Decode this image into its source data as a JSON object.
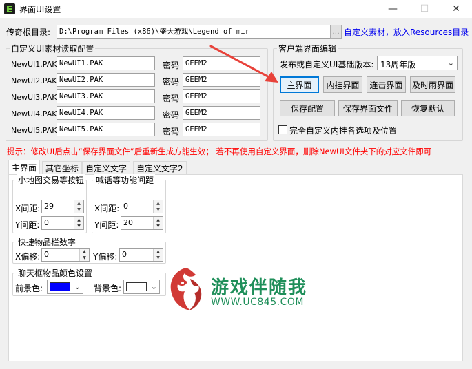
{
  "window": {
    "title": "界面UI设置",
    "minimize": "—",
    "maximize": "☐",
    "close": "✕"
  },
  "root_dir": {
    "label": "传奇根目录:",
    "value": "D:\\Program Files (x86)\\盛大游戏\\Legend of mir",
    "browse": "...",
    "hint_link": "自定义素材，放入Resources目录"
  },
  "materials_group": {
    "title": "自定义UI素材读取配置",
    "password_label": "密码",
    "rows": [
      {
        "label": "NewUI1.PAK",
        "file": "NewUI1.PAK",
        "password": "GEEM2"
      },
      {
        "label": "NewUI2.PAK",
        "file": "NewUI2.PAK",
        "password": "GEEM2"
      },
      {
        "label": "NewUI3.PAK",
        "file": "NewUI3.PAK",
        "password": "GEEM2"
      },
      {
        "label": "NewUI4.PAK",
        "file": "NewUI4.PAK",
        "password": "GEEM2"
      },
      {
        "label": "NewUI5.PAK",
        "file": "NewUI5.PAK",
        "password": "GEEM2"
      }
    ]
  },
  "client_group": {
    "title": "客户端界面编辑",
    "version_label": "发布或自定义UI基础版本:",
    "version_value": "13周年版",
    "view_buttons": [
      "主界面",
      "内挂界面",
      "连击界面",
      "及时雨界面"
    ],
    "action_buttons": [
      "保存配置",
      "保存界面文件",
      "恢复默认"
    ],
    "checkbox_label": "完全自定义内挂各选项及位置"
  },
  "tip": "提示：修改UI后点击“保存界面文件”后重新生成方能生效；   若不再使用自定义界面，删除NewUI文件夹下的对应文件即可",
  "tabs": [
    "主界面",
    "其它坐标",
    "自定义文字",
    "自定义文字2"
  ],
  "minimap_group": {
    "title": "小地图交易等按钮",
    "x_label": "X间距:",
    "x_value": "29",
    "y_label": "Y间距:",
    "y_value": "0"
  },
  "shout_group": {
    "title": "喊话等功能间距",
    "x_label": "X间距:",
    "x_value": "0",
    "y_label": "Y间距:",
    "y_value": "20"
  },
  "quickbar_group": {
    "title": "快捷物品栏数字",
    "x_label": "X偏移:",
    "x_value": "0",
    "y_label": "Y偏移:",
    "y_value": "0"
  },
  "chat_color_group": {
    "title": "聊天框物品颜色设置",
    "fg_label": "前景色:",
    "fg_color": "#0000ff",
    "bg_label": "背景色:",
    "bg_color": "#ffffff"
  },
  "watermark": {
    "title": "游戏伴随我",
    "url": "WWW.UC845.COM"
  },
  "colors": {
    "arrow": "#e8423a",
    "link": "#0000ee",
    "tip": "#ff0000"
  }
}
